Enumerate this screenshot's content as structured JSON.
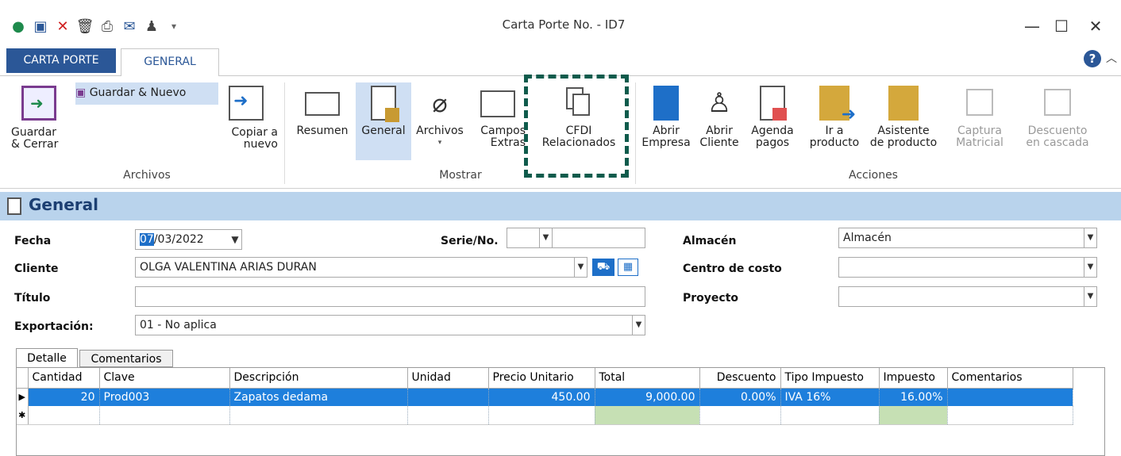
{
  "window": {
    "title": "Carta Porte No. - ID7",
    "minimize": "—",
    "maximize": "☐",
    "close": "✕"
  },
  "tabs": {
    "carta_porte": "CARTA PORTE",
    "general": "GENERAL"
  },
  "help": "?",
  "collapse": "︿",
  "ribbon": {
    "guardar_nuevo": "Guardar & Nuevo",
    "guardar_cerrar": [
      "Guardar",
      "& Cerrar"
    ],
    "copiar": [
      "Copiar a",
      "nuevo"
    ],
    "resumen": "Resumen",
    "general": "General",
    "archivos": "Archivos",
    "campos": [
      "Campos",
      "Extras"
    ],
    "cfdi": [
      "CFDI",
      "Relacionados"
    ],
    "abrir_empresa": [
      "Abrir",
      "Empresa"
    ],
    "abrir_cliente": [
      "Abrir",
      "Cliente"
    ],
    "agenda": [
      "Agenda",
      "pagos"
    ],
    "ir_producto": [
      "Ir a",
      "producto"
    ],
    "asistente": [
      "Asistente",
      "de producto"
    ],
    "captura": [
      "Captura",
      "Matricial"
    ],
    "descuento": [
      "Descuento",
      "en cascada"
    ],
    "groups": {
      "archivos": "Archivos",
      "mostrar": "Mostrar",
      "acciones": "Acciones"
    }
  },
  "section": {
    "title": "General"
  },
  "form": {
    "fecha_label": "Fecha",
    "fecha_day": "07",
    "fecha_rest": "/03/2022",
    "serie_label": "Serie/No.",
    "serie_value": "",
    "numero_value": "",
    "almacen_label": "Almacén",
    "almacen_value": "Almacén",
    "cliente_label": "Cliente",
    "cliente_value": "OLGA VALENTINA ARIAS DURAN",
    "centro_label": "Centro de costo",
    "centro_value": "",
    "titulo_label": "Título",
    "titulo_value": "",
    "proyecto_label": "Proyecto",
    "proyecto_value": "",
    "exportacion_label": "Exportación:",
    "exportacion_value": "01 - No aplica"
  },
  "detail_tabs": {
    "detalle": "Detalle",
    "comentarios": "Comentarios"
  },
  "grid": {
    "headers": [
      "Cantidad",
      "Clave",
      "Descripción",
      "Unidad",
      "Precio Unitario",
      "Total",
      "Descuento",
      "Tipo Impuesto",
      "Impuesto",
      "Comentarios"
    ],
    "row": {
      "indicator": "▶",
      "cantidad": "20",
      "clave": "Prod003",
      "descripcion": "Zapatos dedama",
      "unidad": "",
      "precio": "450.00",
      "total": "9,000.00",
      "descuento": "0.00%",
      "tipo_impuesto": "IVA 16%",
      "impuesto": "16.00%",
      "comentarios": ""
    },
    "new_row_indicator": "✱"
  },
  "colors": {
    "accent": "#2b5797",
    "header_band": "#b9d3ec",
    "selection": "#1e7fdc",
    "dashed_box": "#0f5b4c"
  }
}
